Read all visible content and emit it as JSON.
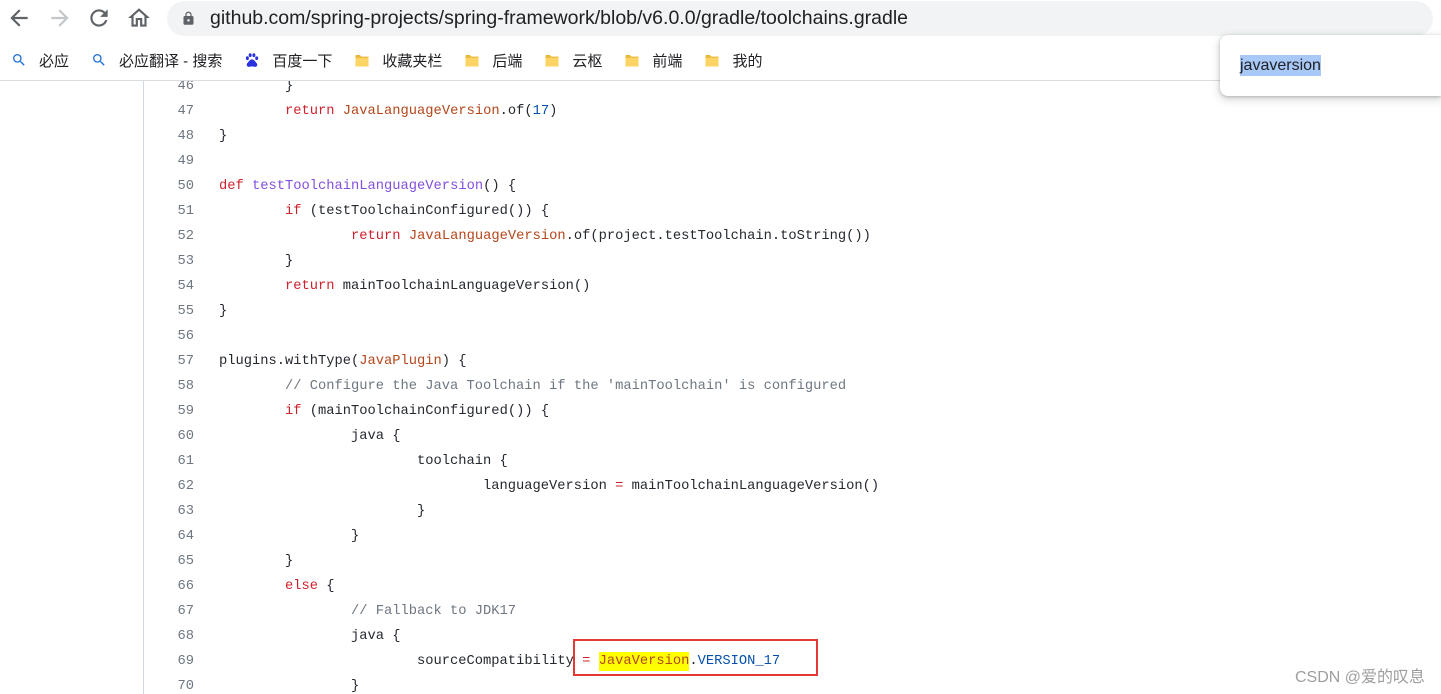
{
  "browser": {
    "url": "github.com/spring-projects/spring-framework/blob/v6.0.0/gradle/toolchains.gradle",
    "toolbar_icons": [
      "back-arrow-icon",
      "forward-arrow-icon",
      "reload-icon",
      "home-icon",
      "lock-icon"
    ],
    "forward_enabled": false
  },
  "bookmarks": [
    {
      "label": "必应",
      "icon": "search-icon"
    },
    {
      "label": "必应翻译 - 搜索",
      "icon": "search-icon"
    },
    {
      "label": "百度一下",
      "icon": "baidu-paw-icon"
    },
    {
      "label": "收藏夹栏",
      "icon": "folder-icon"
    },
    {
      "label": "后端",
      "icon": "folder-icon"
    },
    {
      "label": "云枢",
      "icon": "folder-icon"
    },
    {
      "label": "前端",
      "icon": "folder-icon"
    },
    {
      "label": "我的",
      "icon": "folder-icon"
    }
  ],
  "find_bar": {
    "query": "javaversion",
    "query_selected": true
  },
  "file": {
    "lines": [
      {
        "number": "46",
        "tokens": [
          {
            "text": "\t}"
          }
        ]
      },
      {
        "number": "47",
        "tokens": [
          {
            "text": "\t"
          },
          {
            "text": "return",
            "type": "keyword"
          },
          {
            "text": " "
          },
          {
            "text": "JavaLanguageVersion",
            "type": "class"
          },
          {
            "text": ".of("
          },
          {
            "text": "17",
            "type": "constant"
          },
          {
            "text": ")"
          }
        ]
      },
      {
        "number": "48",
        "tokens": [
          {
            "text": "}"
          }
        ]
      },
      {
        "number": "49",
        "tokens": []
      },
      {
        "number": "50",
        "tokens": [
          {
            "text": "def",
            "type": "keyword"
          },
          {
            "text": " "
          },
          {
            "text": "testToolchainLanguageVersion",
            "type": "entity"
          },
          {
            "text": "() {"
          }
        ]
      },
      {
        "number": "51",
        "tokens": [
          {
            "text": "\t"
          },
          {
            "text": "if",
            "type": "keyword"
          },
          {
            "text": " (testToolchainConfigured()) {"
          }
        ]
      },
      {
        "number": "52",
        "tokens": [
          {
            "text": "\t\t"
          },
          {
            "text": "return",
            "type": "keyword"
          },
          {
            "text": " "
          },
          {
            "text": "JavaLanguageVersion",
            "type": "class"
          },
          {
            "text": ".of(project.testToolchain.toString())"
          }
        ]
      },
      {
        "number": "53",
        "tokens": [
          {
            "text": "\t}"
          }
        ]
      },
      {
        "number": "54",
        "tokens": [
          {
            "text": "\t"
          },
          {
            "text": "return",
            "type": "keyword"
          },
          {
            "text": " mainToolchainLanguageVersion()"
          }
        ]
      },
      {
        "number": "55",
        "tokens": [
          {
            "text": "}"
          }
        ]
      },
      {
        "number": "56",
        "tokens": []
      },
      {
        "number": "57",
        "tokens": [
          {
            "text": "plugins.withType("
          },
          {
            "text": "JavaPlugin",
            "type": "class"
          },
          {
            "text": ") {"
          }
        ]
      },
      {
        "number": "58",
        "tokens": [
          {
            "text": "\t"
          },
          {
            "text": "// Configure the Java Toolchain if the 'mainToolchain' is configured",
            "type": "comment"
          }
        ]
      },
      {
        "number": "59",
        "tokens": [
          {
            "text": "\t"
          },
          {
            "text": "if",
            "type": "keyword"
          },
          {
            "text": " (mainToolchainConfigured()) {"
          }
        ]
      },
      {
        "number": "60",
        "tokens": [
          {
            "text": "\t\tjava {"
          }
        ]
      },
      {
        "number": "61",
        "tokens": [
          {
            "text": "\t\t\ttoolchain {"
          }
        ]
      },
      {
        "number": "62",
        "tokens": [
          {
            "text": "\t\t\t\tlanguageVersion "
          },
          {
            "text": "=",
            "type": "keyword"
          },
          {
            "text": " mainToolchainLanguageVersion()"
          }
        ]
      },
      {
        "number": "63",
        "tokens": [
          {
            "text": "\t\t\t}"
          }
        ]
      },
      {
        "number": "64",
        "tokens": [
          {
            "text": "\t\t}"
          }
        ]
      },
      {
        "number": "65",
        "tokens": [
          {
            "text": "\t}"
          }
        ]
      },
      {
        "number": "66",
        "tokens": [
          {
            "text": "\t"
          },
          {
            "text": "else",
            "type": "keyword"
          },
          {
            "text": " {"
          }
        ]
      },
      {
        "number": "67",
        "tokens": [
          {
            "text": "\t\t"
          },
          {
            "text": "// Fallback to JDK17",
            "type": "comment"
          }
        ]
      },
      {
        "number": "68",
        "tokens": [
          {
            "text": "\t\tjava {"
          }
        ]
      },
      {
        "number": "69",
        "tokens": [
          {
            "text": "\t\t\tsourceCompatibility "
          },
          {
            "text": "=",
            "type": "keyword"
          },
          {
            "text": " "
          },
          {
            "text": "JavaVersion",
            "type": "class",
            "find_match": true
          },
          {
            "text": "."
          },
          {
            "text": "VERSION_17",
            "type": "constant"
          }
        ]
      },
      {
        "number": "70",
        "tokens": [
          {
            "text": "\t\t}"
          }
        ]
      }
    ]
  },
  "watermark": "CSDN @爱的叹息",
  "theme": {
    "keyword": "#cf222e",
    "class_name": "#b4461a",
    "entity": "#8250df",
    "constant": "#0550ae",
    "comment": "#6e7781",
    "code_text": "#24292f",
    "line_number": "#6e7781",
    "find_match": "#ffff00",
    "annotation_box": "#e53935",
    "selection": "#a8c8f8"
  }
}
